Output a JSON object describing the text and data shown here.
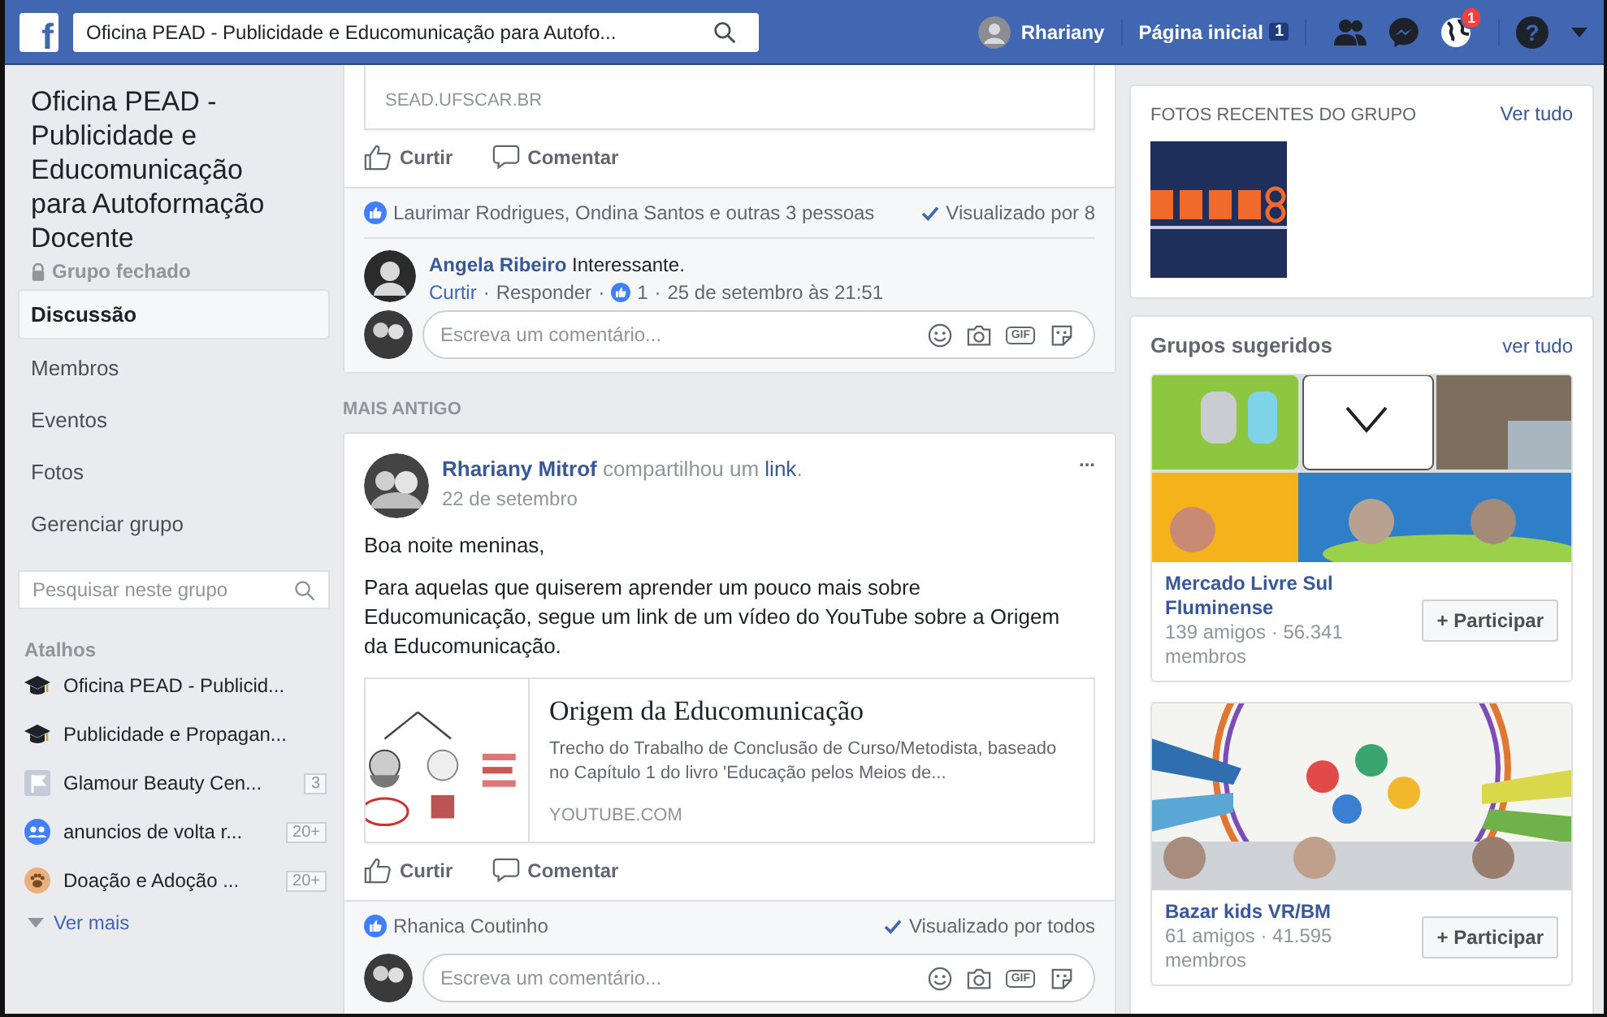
{
  "topbar": {
    "logo": "f",
    "search_value": "Oficina PEAD -  Publicidade e Educomunicação para Autofo...",
    "user": "Rhariany",
    "home": "Página inicial",
    "home_badge": "1",
    "notifications_badge": "1",
    "help": "?"
  },
  "sidebar": {
    "group_name": "Oficina PEAD - Publicidade e Educomunicação para Autoformação Docente",
    "privacy": "Grupo fechado",
    "nav": [
      {
        "label": "Discussão",
        "selected": true
      },
      {
        "label": "Membros",
        "selected": false
      },
      {
        "label": "Eventos",
        "selected": false
      },
      {
        "label": "Fotos",
        "selected": false
      },
      {
        "label": "Gerenciar grupo",
        "selected": false
      }
    ],
    "search": {
      "placeholder": "Pesquisar neste grupo"
    },
    "shortcuts_title": "Atalhos",
    "shortcuts": [
      {
        "kind": "school",
        "label": "Oficina PEAD - Publicid..."
      },
      {
        "kind": "school",
        "label": "Publicidade e Propagan..."
      },
      {
        "kind": "page",
        "label": "Glamour Beauty Cen...",
        "count": "3"
      },
      {
        "kind": "group",
        "label": "anuncios de volta r...",
        "count": "20+"
      },
      {
        "kind": "paw",
        "label": "Doação e Adoção ...",
        "count": "20+"
      }
    ],
    "more": "Ver mais"
  },
  "feed": {
    "separator": "·",
    "first_post": {
      "domain": "SEAD.UFSCAR.BR",
      "actions": [
        "Curtir",
        "Comentar"
      ],
      "likes": "Laurimar Rodrigues, Ondina Santos e outras 3 pessoas",
      "seen": "Visualizado por 8",
      "comment": {
        "author": "Angela Ribeiro",
        "text": "Interessante.",
        "like": "Curtir",
        "reply": "Responder",
        "reactions": "1",
        "time": "25 de setembro às 21:51"
      },
      "comment_placeholder": "Escreva um comentário...",
      "gif_label": "GIF"
    },
    "section_label": "MAIS ANTIGO",
    "second_post": {
      "author": "Rhariany Mitrof",
      "verb": "compartilhou um",
      "object": "link",
      "punct": ".",
      "date": "22 de setembro",
      "menu": "...",
      "paragraphs": [
        "Boa noite meninas,",
        "Para aquelas que quiserem aprender um pouco mais sobre Educomunicação, segue um link de um vídeo do YouTube sobre a Origem da Educomunicação."
      ],
      "link": {
        "title": "Origem da Educomunicação",
        "description": "Trecho do Trabalho de Conclusão de Curso/Metodista, baseado no Capítulo 1 do livro 'Educação pelos Meios de...",
        "domain": "YOUTUBE.COM"
      },
      "actions": [
        "Curtir",
        "Comentar"
      ],
      "likes": "Rhanica Coutinho",
      "seen": "Visualizado por todos",
      "comment_placeholder": "Escreva um comentário...",
      "gif_label": "GIF"
    }
  },
  "right": {
    "photos": {
      "title": "FOTOS RECENTES DO GRUPO",
      "link": "Ver tudo"
    },
    "suggested": {
      "title": "Grupos sugeridos",
      "link": "ver tudo",
      "groups": [
        {
          "name": "Mercado Livre Sul Fluminense",
          "stats": "139 amigos · 56.341 membros",
          "button": "+ Participar"
        },
        {
          "name": "Bazar kids VR/BM",
          "stats": "61 amigos · 41.595 membros",
          "button": "+ Participar"
        }
      ]
    }
  }
}
